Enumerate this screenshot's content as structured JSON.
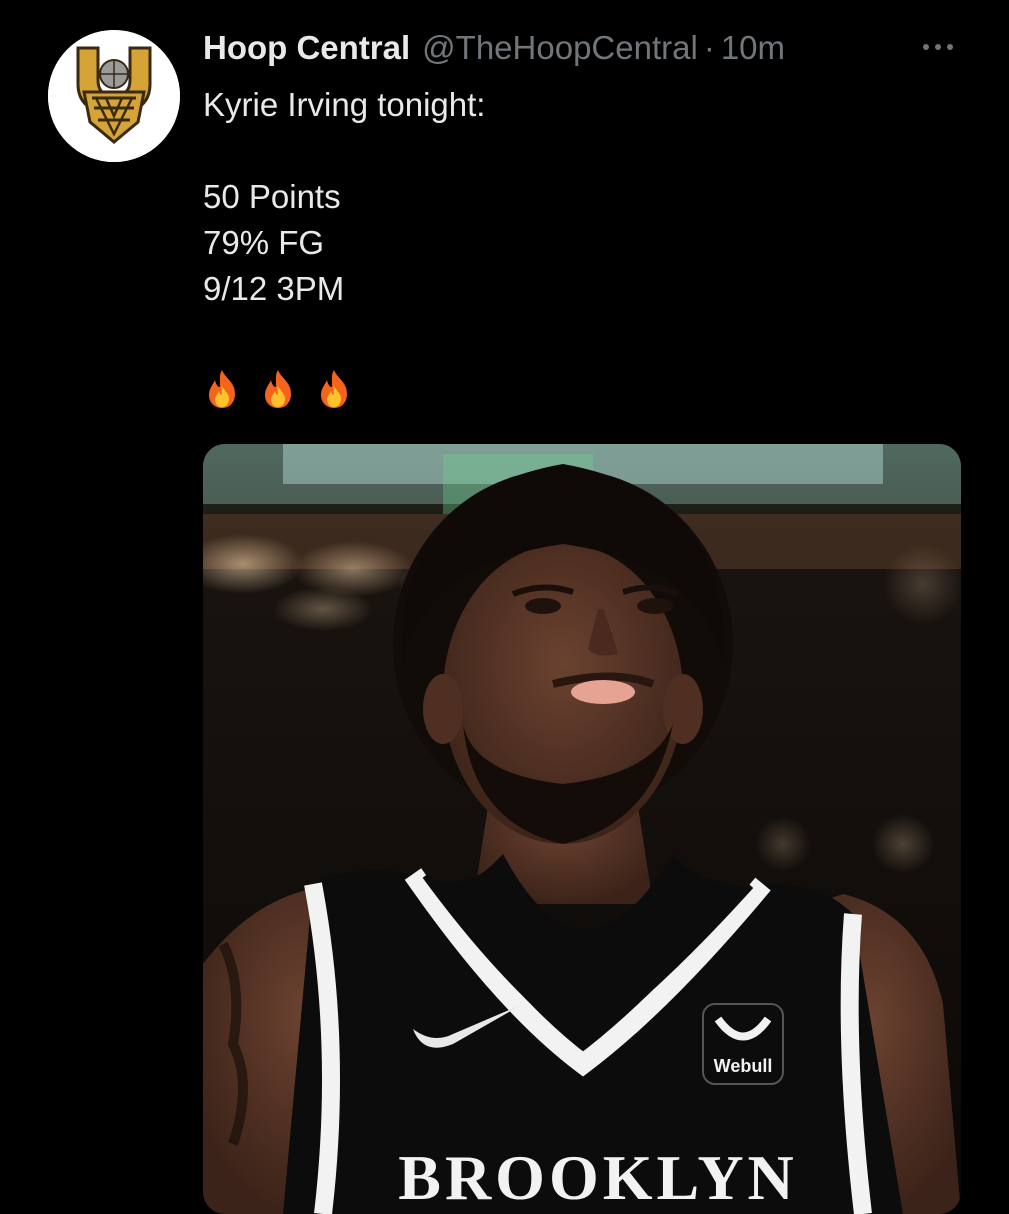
{
  "tweet": {
    "author": {
      "display_name": "Hoop Central",
      "handle": "@TheHoopCentral",
      "separator": "·",
      "time": "10m",
      "avatar_icon": "hoop-central-logo"
    },
    "more_icon": "more-options-icon",
    "text": {
      "line1": "Kyrie Irving tonight:",
      "line2": "50 Points",
      "line3": "79% FG",
      "line4": "9/12 3PM",
      "emojis": [
        "fire-emoji",
        "fire-emoji",
        "fire-emoji"
      ]
    },
    "media": {
      "jersey_sponsor": "Webull",
      "jersey_wordmark": "BROOKLYN"
    }
  },
  "colors": {
    "background": "#000000",
    "primary_text": "#e7e9ea",
    "secondary_text": "#71767b",
    "logo_gold": "#d6a436",
    "logo_dark": "#3a2a12"
  }
}
